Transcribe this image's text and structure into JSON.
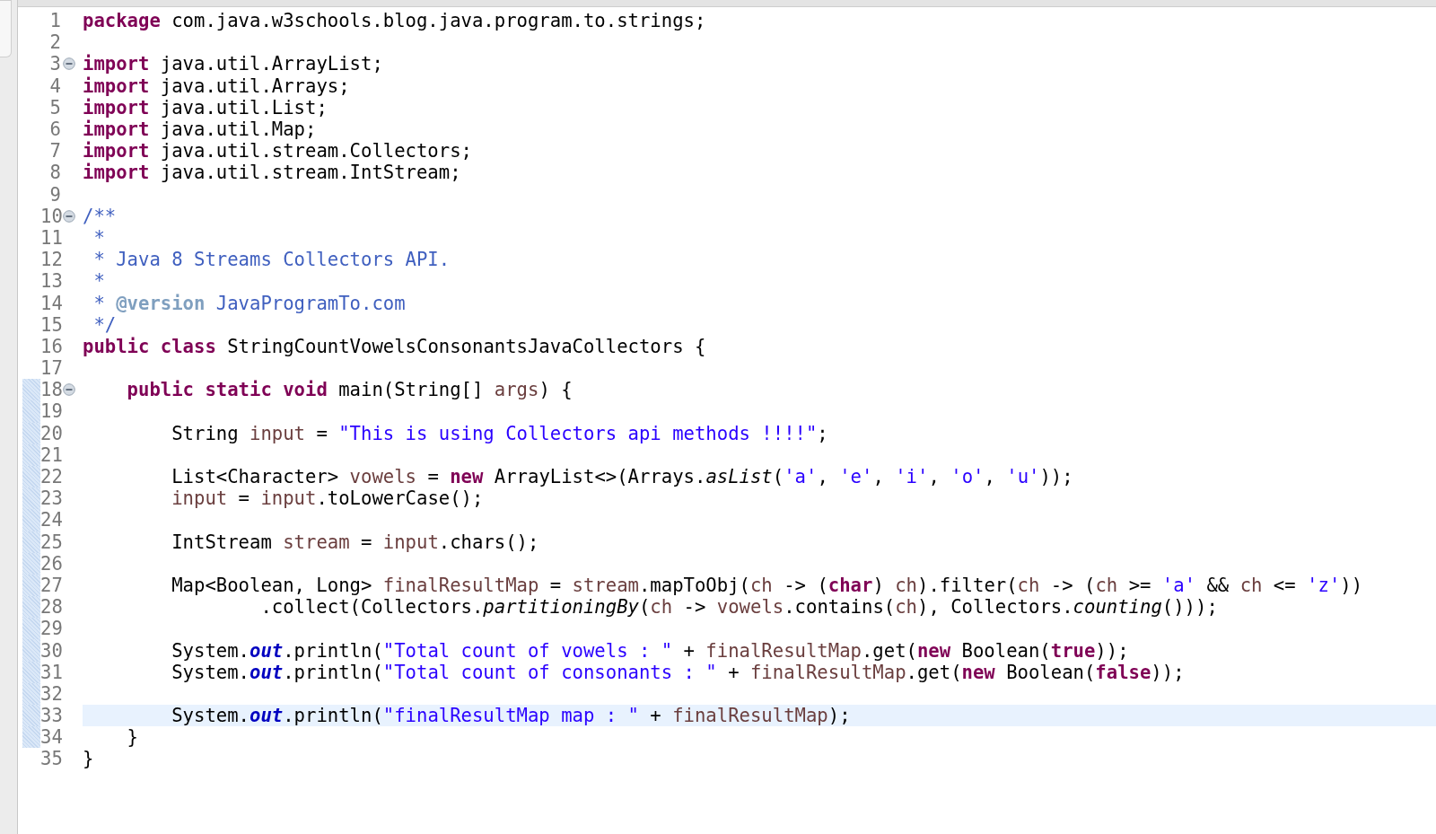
{
  "editor": {
    "lines": [
      {
        "number": "1",
        "tokens": [
          {
            "kind": "keyword",
            "text": "package"
          },
          {
            "kind": "plain",
            "text": " com.java.w3schools.blog.java.program.to.strings;"
          }
        ]
      },
      {
        "number": "2"
      },
      {
        "number": "3",
        "folded": false,
        "tokens": [
          {
            "kind": "keyword",
            "text": "import"
          },
          {
            "kind": "plain",
            "text": " java.util.ArrayList;"
          }
        ]
      },
      {
        "number": "4",
        "tokens": [
          {
            "kind": "keyword",
            "text": "import"
          },
          {
            "kind": "plain",
            "text": " java.util.Arrays;"
          }
        ]
      },
      {
        "number": "5",
        "tokens": [
          {
            "kind": "keyword",
            "text": "import"
          },
          {
            "kind": "plain",
            "text": " java.util.List;"
          }
        ]
      },
      {
        "number": "6",
        "tokens": [
          {
            "kind": "keyword",
            "text": "import"
          },
          {
            "kind": "plain",
            "text": " java.util.Map;"
          }
        ]
      },
      {
        "number": "7",
        "tokens": [
          {
            "kind": "keyword",
            "text": "import"
          },
          {
            "kind": "plain",
            "text": " java.util.stream.Collectors;"
          }
        ]
      },
      {
        "number": "8",
        "tokens": [
          {
            "kind": "keyword",
            "text": "import"
          },
          {
            "kind": "plain",
            "text": " java.util.stream.IntStream;"
          }
        ]
      },
      {
        "number": "9"
      },
      {
        "number": "10",
        "folded": false,
        "tokens": [
          {
            "kind": "comment",
            "text": "/**"
          }
        ]
      },
      {
        "number": "11",
        "tokens": [
          {
            "kind": "comment",
            "text": " *"
          }
        ]
      },
      {
        "number": "12",
        "tokens": [
          {
            "kind": "comment",
            "text": " * Java 8 Streams Collectors API."
          }
        ]
      },
      {
        "number": "13",
        "tokens": [
          {
            "kind": "comment",
            "text": " *"
          }
        ]
      },
      {
        "number": "14",
        "tokens": [
          {
            "kind": "comment",
            "text": " * "
          },
          {
            "kind": "doc_tag",
            "text": "@version"
          },
          {
            "kind": "comment",
            "text": " JavaProgramTo.com"
          }
        ]
      },
      {
        "number": "15",
        "tokens": [
          {
            "kind": "comment",
            "text": " */"
          }
        ]
      },
      {
        "number": "16",
        "tokens": [
          {
            "kind": "keyword",
            "text": "public"
          },
          {
            "kind": "keyword",
            "text": " class"
          },
          {
            "kind": "plain",
            "text": " StringCountVowelsConsonantsJavaCollectors {"
          }
        ]
      },
      {
        "number": "17"
      },
      {
        "number": "18",
        "folded": false,
        "changed": true,
        "tokens": [
          {
            "kind": "keyword",
            "text": "    public"
          },
          {
            "kind": "keyword",
            "text": " static"
          },
          {
            "kind": "keyword",
            "text": " void"
          },
          {
            "kind": "plain",
            "text": " main(String[] "
          },
          {
            "kind": "local",
            "text": "args"
          },
          {
            "kind": "plain",
            "text": ") {"
          }
        ]
      },
      {
        "number": "19",
        "changed": true
      },
      {
        "number": "20",
        "changed": true,
        "tokens": [
          {
            "kind": "plain",
            "text": "        String "
          },
          {
            "kind": "local",
            "text": "input"
          },
          {
            "kind": "plain",
            "text": " = "
          },
          {
            "kind": "string",
            "text": "\"This is using Collectors api methods !!!!\""
          },
          {
            "kind": "plain",
            "text": ";"
          }
        ]
      },
      {
        "number": "21",
        "changed": true
      },
      {
        "number": "22",
        "changed": true,
        "tokens": [
          {
            "kind": "plain",
            "text": "        List<Character> "
          },
          {
            "kind": "local",
            "text": "vowels"
          },
          {
            "kind": "plain",
            "text": " = "
          },
          {
            "kind": "keyword",
            "text": "new"
          },
          {
            "kind": "plain",
            "text": " ArrayList<>(Arrays."
          },
          {
            "kind": "static_method",
            "text": "asList"
          },
          {
            "kind": "plain",
            "text": "("
          },
          {
            "kind": "string",
            "text": "'a'"
          },
          {
            "kind": "plain",
            "text": ", "
          },
          {
            "kind": "string",
            "text": "'e'"
          },
          {
            "kind": "plain",
            "text": ", "
          },
          {
            "kind": "string",
            "text": "'i'"
          },
          {
            "kind": "plain",
            "text": ", "
          },
          {
            "kind": "string",
            "text": "'o'"
          },
          {
            "kind": "plain",
            "text": ", "
          },
          {
            "kind": "string",
            "text": "'u'"
          },
          {
            "kind": "plain",
            "text": "));"
          }
        ]
      },
      {
        "number": "23",
        "changed": true,
        "tokens": [
          {
            "kind": "local",
            "text": "        input"
          },
          {
            "kind": "plain",
            "text": " = "
          },
          {
            "kind": "local",
            "text": "input"
          },
          {
            "kind": "plain",
            "text": ".toLowerCase();"
          }
        ]
      },
      {
        "number": "24",
        "changed": true
      },
      {
        "number": "25",
        "changed": true,
        "tokens": [
          {
            "kind": "plain",
            "text": "        IntStream "
          },
          {
            "kind": "local",
            "text": "stream"
          },
          {
            "kind": "plain",
            "text": " = "
          },
          {
            "kind": "local",
            "text": "input"
          },
          {
            "kind": "plain",
            "text": ".chars();"
          }
        ]
      },
      {
        "number": "26",
        "changed": true
      },
      {
        "number": "27",
        "changed": true,
        "tokens": [
          {
            "kind": "plain",
            "text": "        Map<Boolean, Long> "
          },
          {
            "kind": "local",
            "text": "finalResultMap"
          },
          {
            "kind": "plain",
            "text": " = "
          },
          {
            "kind": "local",
            "text": "stream"
          },
          {
            "kind": "plain",
            "text": ".mapToObj("
          },
          {
            "kind": "local",
            "text": "ch"
          },
          {
            "kind": "plain",
            "text": " -> ("
          },
          {
            "kind": "keyword",
            "text": "char"
          },
          {
            "kind": "plain",
            "text": ") "
          },
          {
            "kind": "local",
            "text": "ch"
          },
          {
            "kind": "plain",
            "text": ").filter("
          },
          {
            "kind": "local",
            "text": "ch"
          },
          {
            "kind": "plain",
            "text": " -> ("
          },
          {
            "kind": "local",
            "text": "ch"
          },
          {
            "kind": "plain",
            "text": " >= "
          },
          {
            "kind": "string",
            "text": "'a'"
          },
          {
            "kind": "plain",
            "text": " && "
          },
          {
            "kind": "local",
            "text": "ch"
          },
          {
            "kind": "plain",
            "text": " <= "
          },
          {
            "kind": "string",
            "text": "'z'"
          },
          {
            "kind": "plain",
            "text": "))"
          }
        ]
      },
      {
        "number": "28",
        "changed": true,
        "tokens": [
          {
            "kind": "plain",
            "text": "                .collect(Collectors."
          },
          {
            "kind": "static_method",
            "text": "partitioningBy"
          },
          {
            "kind": "plain",
            "text": "("
          },
          {
            "kind": "local",
            "text": "ch"
          },
          {
            "kind": "plain",
            "text": " -> "
          },
          {
            "kind": "local",
            "text": "vowels"
          },
          {
            "kind": "plain",
            "text": ".contains("
          },
          {
            "kind": "local",
            "text": "ch"
          },
          {
            "kind": "plain",
            "text": "), Collectors."
          },
          {
            "kind": "static_method",
            "text": "counting"
          },
          {
            "kind": "plain",
            "text": "()));"
          }
        ]
      },
      {
        "number": "29",
        "changed": true
      },
      {
        "number": "30",
        "changed": true,
        "tokens": [
          {
            "kind": "plain",
            "text": "        System."
          },
          {
            "kind": "static_field",
            "text": "out"
          },
          {
            "kind": "plain",
            "text": ".println("
          },
          {
            "kind": "string",
            "text": "\"Total count of vowels : \""
          },
          {
            "kind": "plain",
            "text": " + "
          },
          {
            "kind": "local",
            "text": "finalResultMap"
          },
          {
            "kind": "plain",
            "text": ".get("
          },
          {
            "kind": "keyword",
            "text": "new"
          },
          {
            "kind": "plain",
            "text": " Boolean("
          },
          {
            "kind": "keyword",
            "text": "true"
          },
          {
            "kind": "plain",
            "text": "));"
          }
        ]
      },
      {
        "number": "31",
        "changed": true,
        "tokens": [
          {
            "kind": "plain",
            "text": "        System."
          },
          {
            "kind": "static_field",
            "text": "out"
          },
          {
            "kind": "plain",
            "text": ".println("
          },
          {
            "kind": "string",
            "text": "\"Total count of consonants : \""
          },
          {
            "kind": "plain",
            "text": " + "
          },
          {
            "kind": "local",
            "text": "finalResultMap"
          },
          {
            "kind": "plain",
            "text": ".get("
          },
          {
            "kind": "keyword",
            "text": "new"
          },
          {
            "kind": "plain",
            "text": " Boolean("
          },
          {
            "kind": "keyword",
            "text": "false"
          },
          {
            "kind": "plain",
            "text": "));"
          }
        ]
      },
      {
        "number": "32",
        "changed": true
      },
      {
        "number": "33",
        "changed": true,
        "selected": true,
        "tokens": [
          {
            "kind": "plain",
            "text": "        System."
          },
          {
            "kind": "static_field",
            "text": "out"
          },
          {
            "kind": "plain",
            "text": ".println("
          },
          {
            "kind": "string",
            "text": "\"finalResultMap map : \""
          },
          {
            "kind": "plain",
            "text": " + "
          },
          {
            "kind": "local",
            "text": "finalResultMap"
          },
          {
            "kind": "plain",
            "text": ");"
          }
        ]
      },
      {
        "number": "34",
        "changed": true,
        "tokens": [
          {
            "kind": "plain",
            "text": "    }"
          }
        ]
      },
      {
        "number": "35",
        "tokens": [
          {
            "kind": "plain",
            "text": "}"
          }
        ]
      }
    ]
  }
}
